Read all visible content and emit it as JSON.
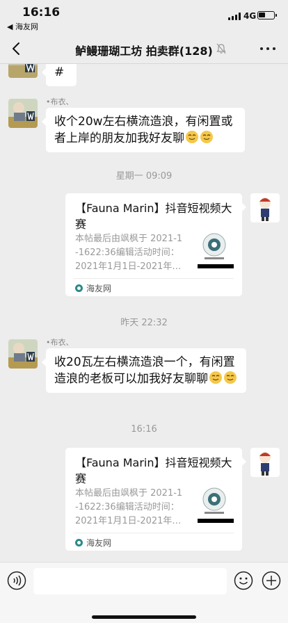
{
  "status": {
    "time": "16:16",
    "back_app": "◀ 海友网",
    "network": "4G"
  },
  "nav": {
    "title": "鲈鳗珊瑚工坊 拍卖群(128)"
  },
  "messages": {
    "m0": {
      "text": "#"
    },
    "m1": {
      "sender": "•布衣、",
      "text": "收个20w左右横流造浪，有闲置或者上岸的朋友加我好友聊"
    },
    "t1": "星期一 09:09",
    "c1": {
      "title": "【Fauna Marin】抖音短视频大赛",
      "desc_line1": "本帖最后由飒枫于 2021-1",
      "desc_line2": "-1622:36编辑活动时间：",
      "desc_line3": "2021年1月1日-2021年…",
      "source": "海友网"
    },
    "t2": "昨天 22:32",
    "m2": {
      "sender": "•布衣、",
      "text": "收20瓦左右横流造浪一个，有闲置造浪的老板可以加我好友聊聊"
    },
    "t3": "16:16",
    "c2": {
      "title": "【Fauna Marin】抖音短视频大赛",
      "desc_line1": "本帖最后由飒枫于 2021-1",
      "desc_line2": "-1622:36编辑活动时间：",
      "desc_line3": "2021年1月1日-2021年…",
      "source": "海友网"
    }
  },
  "icons": [
    "back-icon",
    "mute-icon",
    "more-icon",
    "voice-icon",
    "emoji-icon",
    "plus-icon",
    "signal-icon",
    "battery-icon"
  ],
  "colors": {
    "background": "#ededed",
    "bubble": "#ffffff",
    "timestamp": "#999999",
    "source_icon": "#2b8a8a"
  }
}
